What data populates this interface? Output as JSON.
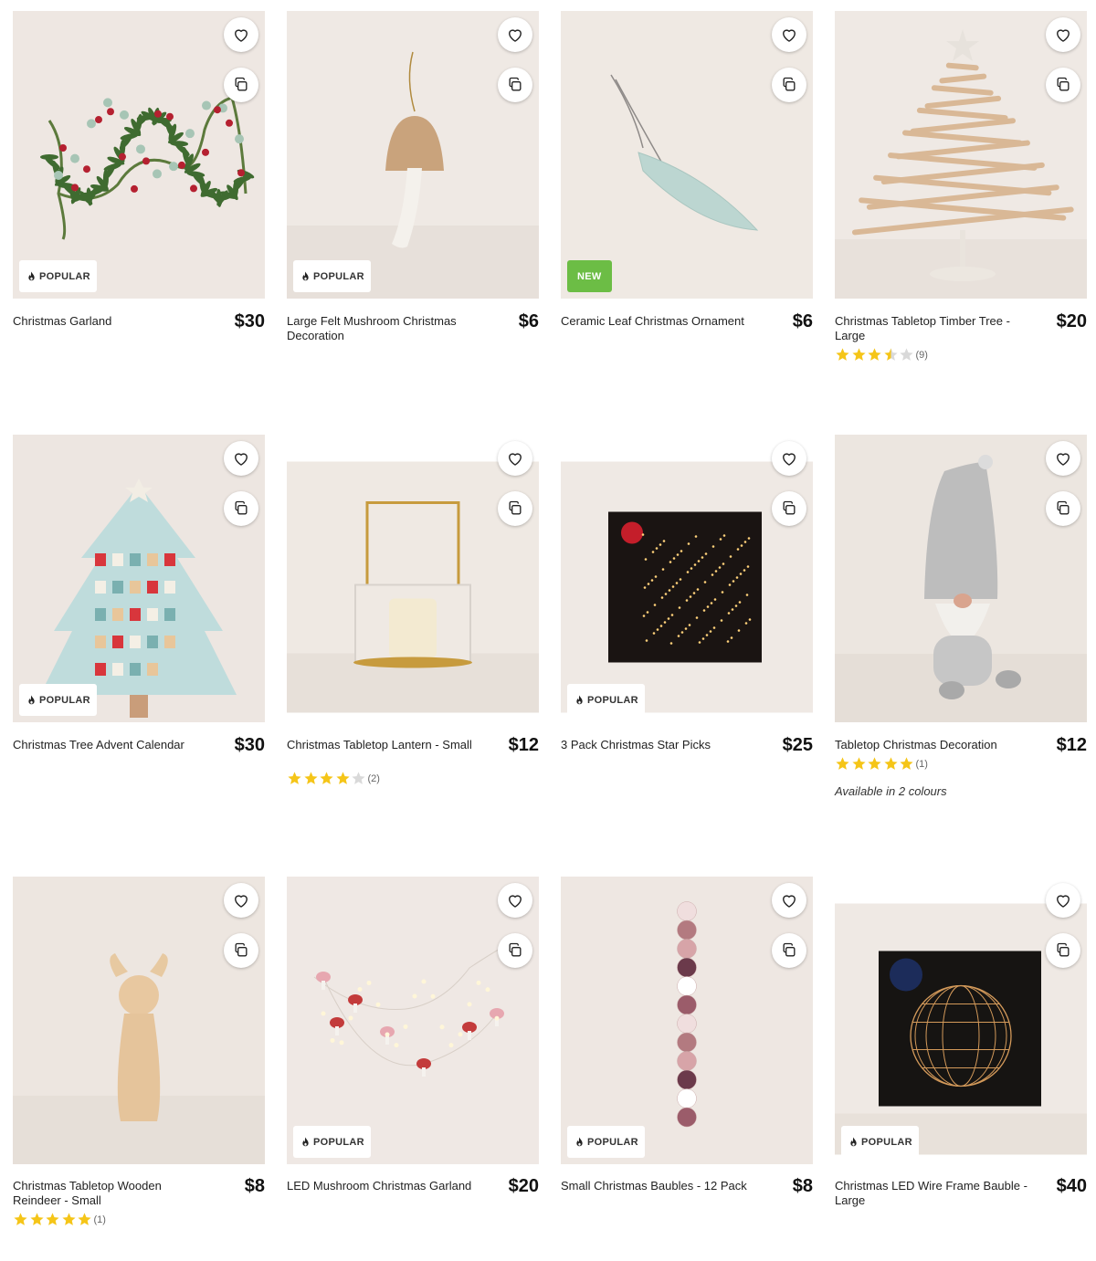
{
  "colors": {
    "accent_new": "#6cbd45",
    "star": "#f5c518",
    "bg": "#ffffff"
  },
  "icons": {
    "wishlist": "heart-icon",
    "compare": "compare-icon",
    "popular": "flame-icon"
  },
  "products": [
    {
      "title": "Christmas Garland",
      "price": "$30",
      "badge": "POPULAR",
      "badge_type": "popular",
      "rating": null,
      "reviews": null,
      "colours": null,
      "scene": "garland"
    },
    {
      "title": "Large Felt Mushroom Christmas Decoration",
      "price": "$6",
      "badge": "POPULAR",
      "badge_type": "popular",
      "rating": null,
      "reviews": null,
      "colours": null,
      "scene": "mushroom"
    },
    {
      "title": "Ceramic Leaf Christmas Ornament",
      "price": "$6",
      "badge": "NEW",
      "badge_type": "new",
      "rating": null,
      "reviews": null,
      "colours": null,
      "scene": "leaf"
    },
    {
      "title": "Christmas Tabletop Timber Tree - Large",
      "price": "$20",
      "badge": null,
      "badge_type": null,
      "rating": 3.5,
      "reviews": "(9)",
      "colours": null,
      "scene": "timbertree"
    },
    {
      "title": "Christmas Tree Advent Calendar",
      "price": "$30",
      "badge": "POPULAR",
      "badge_type": "popular",
      "rating": null,
      "reviews": null,
      "colours": null,
      "scene": "advent"
    },
    {
      "title": "Christmas Tabletop Lantern - Small",
      "price": "$12",
      "badge": null,
      "badge_type": null,
      "rating": 4,
      "reviews": "(2)",
      "colours": null,
      "scene": "lantern"
    },
    {
      "title": "3 Pack Christmas Star Picks",
      "price": "$25",
      "badge": "POPULAR",
      "badge_type": "popular",
      "rating": null,
      "reviews": null,
      "colours": null,
      "scene": "starpicks"
    },
    {
      "title": "Tabletop Christmas Decoration",
      "price": "$12",
      "badge": null,
      "badge_type": null,
      "rating": 5,
      "reviews": "(1)",
      "colours": "Available in 2 colours",
      "scene": "gnome"
    },
    {
      "title": "Christmas Tabletop Wooden Reindeer - Small",
      "price": "$8",
      "badge": null,
      "badge_type": null,
      "rating": 5,
      "reviews": "(1)",
      "colours": null,
      "scene": "reindeer"
    },
    {
      "title": "LED Mushroom Christmas Garland",
      "price": "$20",
      "badge": "POPULAR",
      "badge_type": "popular",
      "rating": null,
      "reviews": null,
      "colours": null,
      "scene": "ledgarland"
    },
    {
      "title": "Small Christmas Baubles - 12 Pack",
      "price": "$8",
      "badge": "POPULAR",
      "badge_type": "popular",
      "rating": null,
      "reviews": null,
      "colours": null,
      "scene": "baubles"
    },
    {
      "title": "Christmas LED Wire Frame Bauble - Large",
      "price": "$40",
      "badge": "POPULAR",
      "badge_type": "popular",
      "rating": null,
      "reviews": null,
      "colours": null,
      "scene": "wirebauble"
    }
  ]
}
